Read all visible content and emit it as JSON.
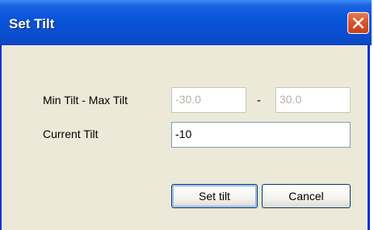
{
  "window": {
    "title": "Set Tilt"
  },
  "form": {
    "range_label": "Min Tilt - Max Tilt",
    "min_value": "-30.0",
    "separator": "-",
    "max_value": "30.0",
    "current_label": "Current Tilt",
    "current_value": "-10"
  },
  "buttons": {
    "set_label": "Set tilt",
    "cancel_label": "Cancel"
  },
  "icons": {
    "close": "close-icon"
  },
  "colors": {
    "titlebar": "#0a55d8",
    "close_button": "#d8562d",
    "window_bg": "#ece9d8"
  }
}
